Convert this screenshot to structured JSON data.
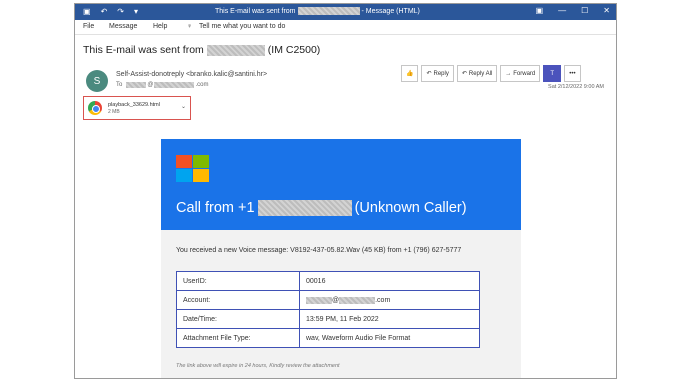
{
  "titlebar": {
    "title_prefix": "This E-mail was sent from",
    "title_suffix": "- Message (HTML)",
    "icons": {
      "save": "▣",
      "undo": "↶",
      "redo": "↷",
      "more": "▾"
    }
  },
  "window_controls": {
    "restore_ribbon": "▣",
    "minimize": "—",
    "maximize": "☐",
    "close": "✕"
  },
  "menu": {
    "file": "File",
    "message": "Message",
    "help": "Help",
    "search_icon": "♀",
    "search_placeholder": "Tell me what you want to do"
  },
  "email": {
    "subject_prefix": "This E-mail was sent from",
    "subject_suffix": "(IM C2500)",
    "avatar_initial": "S",
    "from": "Self-Assist-donotreply <branko.kalic@santini.hr>",
    "to_prefix": "To",
    "to_at": "@",
    "to_domain": ".com",
    "date": "Sat 2/12/2022 9:00 AM"
  },
  "actions": {
    "like_icon": "👍",
    "reply_icon": "↶",
    "reply": "Reply",
    "reply_all_icon": "↶",
    "reply_all": "Reply All",
    "forward_icon": "→",
    "forward": "Forward",
    "teams_icon": "T",
    "more_icon": "•••"
  },
  "attachment": {
    "name": "playback_33629.html",
    "size": "2 MB",
    "dropdown_icon": "⌄"
  },
  "body": {
    "call_prefix": "Call from +1",
    "call_suffix": "(Unknown Caller)",
    "voice_message": "You received a new Voice message: V8192-437-05.82.Wav (45 KB) from +1 (796) 627-5777",
    "table": {
      "userid_label": "UserID:",
      "userid_value": "00016",
      "account_label": "Account:",
      "account_at": "@",
      "account_domain": ".com",
      "datetime_label": "Date/Time:",
      "datetime_value": "13:59 PM, 11 Feb 2022",
      "attachment_label": "Attachment File Type:",
      "attachment_value": "wav, Waveform Audio File Format"
    },
    "expire_note": "The link above will expire in 24 hours, Kindly review the attachment"
  },
  "colors": {
    "titlebar": "#2b579a",
    "banner": "#1a73e8",
    "ms_red": "#f25022",
    "ms_green": "#7fba00",
    "ms_blue": "#00a4ef",
    "ms_yellow": "#ffb900"
  }
}
